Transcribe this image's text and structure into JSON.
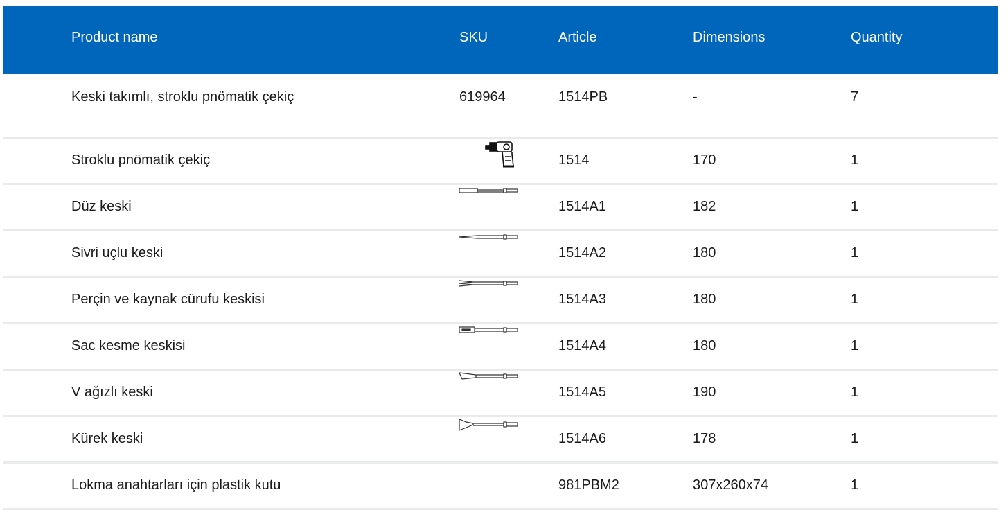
{
  "table": {
    "headers": {
      "name": "Product name",
      "sku": "SKU",
      "article": "Article",
      "dimensions": "Dimensions",
      "quantity": "Quantity"
    },
    "rows": [
      {
        "name": "Keski takımlı, stroklu pnömatik çekiç",
        "sku": "619964",
        "sku_icon": "",
        "article": "1514PB",
        "dimensions": "-",
        "quantity": "7"
      },
      {
        "name": "Stroklu pnömatik çekiç",
        "sku": "",
        "sku_icon": "air-hammer-icon",
        "article": "1514",
        "dimensions": "170",
        "quantity": "1"
      },
      {
        "name": "Düz keski",
        "sku": "",
        "sku_icon": "flat-chisel-icon",
        "article": "1514A1",
        "dimensions": "182",
        "quantity": "1"
      },
      {
        "name": "Sivri uçlu keski",
        "sku": "",
        "sku_icon": "point-chisel-icon",
        "article": "1514A2",
        "dimensions": "180",
        "quantity": "1"
      },
      {
        "name": "Perçin ve kaynak cürufu keskisi",
        "sku": "",
        "sku_icon": "rivet-cutter-chisel-icon",
        "article": "1514A3",
        "dimensions": "180",
        "quantity": "1"
      },
      {
        "name": "Sac kesme keskisi",
        "sku": "",
        "sku_icon": "panel-cutter-chisel-icon",
        "article": "1514A4",
        "dimensions": "180",
        "quantity": "1"
      },
      {
        "name": "V ağızlı keski",
        "sku": "",
        "sku_icon": "v-chisel-icon",
        "article": "1514A5",
        "dimensions": "190",
        "quantity": "1"
      },
      {
        "name": "Kürek keski",
        "sku": "",
        "sku_icon": "scraper-chisel-icon",
        "article": "1514A6",
        "dimensions": "178",
        "quantity": "1"
      },
      {
        "name": "Lokma anahtarları için plastik kutu",
        "sku": "",
        "sku_icon": "",
        "article": "981PBM2",
        "dimensions": "307x260x74",
        "quantity": "1"
      }
    ]
  },
  "colors": {
    "header_bg": "#0066bb",
    "header_text": "#ffffff",
    "row_divider": "#e9eaec"
  }
}
